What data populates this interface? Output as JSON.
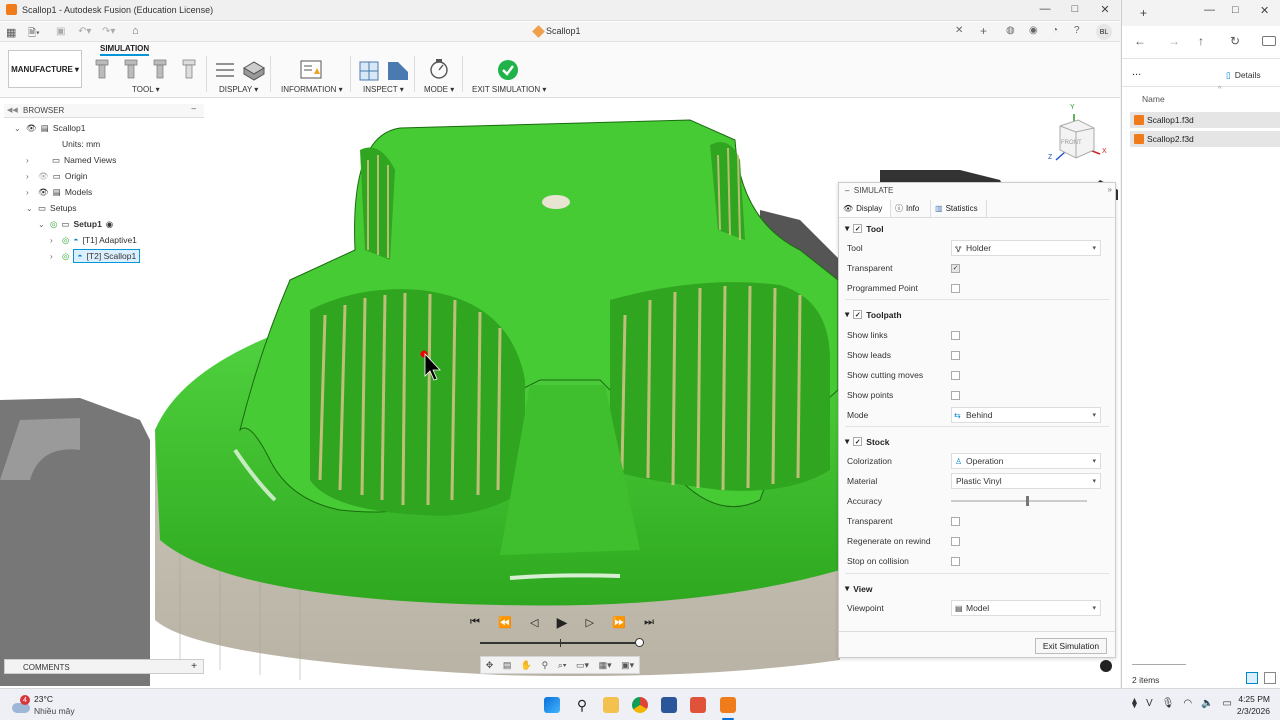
{
  "window": {
    "title": "Scallop1 - Autodesk Fusion (Education License)",
    "doc_tab": "Scallop1",
    "user_initials": "BL"
  },
  "ribbon": {
    "workspace": "MANUFACTURE",
    "active_tab": "SIMULATION",
    "groups": [
      {
        "label": "TOOL ▾"
      },
      {
        "label": "DISPLAY ▾"
      },
      {
        "label": "INFORMATION ▾"
      },
      {
        "label": "INSPECT ▾"
      },
      {
        "label": "MODE ▾"
      },
      {
        "label": "EXIT SIMULATION ▾"
      }
    ]
  },
  "browser": {
    "header": "BROWSER",
    "items": [
      {
        "label": "Scallop1"
      },
      {
        "label": "Units: mm"
      },
      {
        "label": "Named Views"
      },
      {
        "label": "Origin"
      },
      {
        "label": "Models"
      },
      {
        "label": "Setups"
      },
      {
        "label": "Setup1"
      },
      {
        "label": "[T1] Adaptive1"
      },
      {
        "label": "[T2] Scallop1"
      }
    ]
  },
  "comments": {
    "label": "COMMENTS",
    "add": "+"
  },
  "viewcube": {
    "face": "FRONT",
    "axis_y": "Y",
    "axis_z": "Z",
    "axis_x": "X"
  },
  "simulate": {
    "title": "SIMULATE",
    "tabs": [
      "Display",
      "Info",
      "Statistics"
    ],
    "sections": {
      "tool": "Tool",
      "toolpath": "Toolpath",
      "stock": "Stock",
      "view": "View"
    },
    "rows": {
      "tool_label": "Tool",
      "tool_value": "Holder",
      "transparent_label": "Transparent",
      "programmed_point_label": "Programmed Point",
      "show_links": "Show links",
      "show_leads": "Show leads",
      "show_cutting_moves": "Show cutting moves",
      "show_points": "Show points",
      "mode_label": "Mode",
      "mode_value": "Behind",
      "colorization_label": "Colorization",
      "colorization_value": "Operation",
      "material_label": "Material",
      "material_value": "Plastic Vinyl",
      "accuracy_label": "Accuracy",
      "stock_transparent_label": "Transparent",
      "regenerate_label": "Regenerate on rewind",
      "stop_collision_label": "Stop on collision",
      "viewpoint_label": "Viewpoint",
      "viewpoint_value": "Model"
    },
    "accuracy_fraction": 0.55,
    "exit_button": "Exit Simulation"
  },
  "playback": {
    "progress_fraction": 1.0
  },
  "explorer": {
    "details": "Details",
    "more": "...",
    "col_name": "Name",
    "files": [
      "Scallop1.f3d",
      "Scallop2.f3d"
    ],
    "status": "2 items"
  },
  "taskbar": {
    "weather_temp": "23°C",
    "weather_desc": "Nhiều mây",
    "weather_badge": "4",
    "time": "4:25 PM",
    "date": "2/3/2026"
  },
  "colors": {
    "part_green": "#3cc02c",
    "stock_tan": "#c9c4b7",
    "accent_blue": "#0696d7"
  }
}
